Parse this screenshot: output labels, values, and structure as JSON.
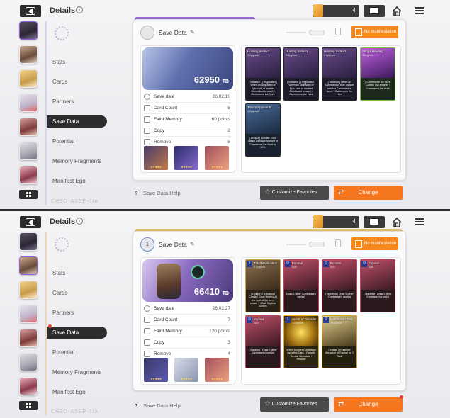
{
  "screens": [
    {
      "header": {
        "title": "Details",
        "currency_value": "4"
      },
      "nav": [
        "Stats",
        "Cards",
        "Partners",
        "Save Data",
        "Potential",
        "Memory Fragments",
        "Manifest Ego"
      ],
      "footer_code": "CHSO-ASSP-3/A",
      "panel": {
        "title": "Save Data",
        "manifestation_label": "No manifestation",
        "banner_value": "62950",
        "banner_unit": "TB",
        "stats": [
          {
            "label": "Save date",
            "value": "26.02.10"
          },
          {
            "label": "Card Count",
            "value": "5"
          },
          {
            "label": "Faint Memory",
            "value": "60 points"
          },
          {
            "label": "Copy",
            "value": "2"
          },
          {
            "label": "Remove",
            "value": "5"
          }
        ],
        "cards": [
          {
            "name": "Hunting Instinct",
            "upgrade": "4 Upgrade",
            "desc": "[ Initiation ] [ Reglicated ] When an Upgraded or Epic card of another Combatant is used, ! Commence the Hunt"
          },
          {
            "name": "Hunting Instinct",
            "upgrade": "4 Upgrade",
            "desc": "[ Initiation ] [ Reglicated ] When an Upgraded or Epic card of another Combatant is used, ! Commence the Hunt"
          },
          {
            "name": "Hunting Instinct",
            "upgrade": "4 Upgrade",
            "desc": "[ Initiation ] When an Upgraded or Epic card of another Combatant is used, ! Commence the Hunt"
          },
          {
            "name": "Stings Howling",
            "upgrade": "4 Upgrade",
            "desc": "[ Commence the Hunt Combo ] All another ! Commence the Hunt"
          },
          {
            "name": "Titan's Approach",
            "upgrade": "4 Upgrade",
            "desc": "[ Unique ] Activate Extra Attack Damage Amount of Commence the Hunt by 40%"
          }
        ]
      },
      "help_label": "Save Data Help",
      "favorites_label": "Customize Favorites",
      "change_label": "Change"
    },
    {
      "header": {
        "title": "Details",
        "currency_value": "4"
      },
      "nav": [
        "Stats",
        "Cards",
        "Partners",
        "Save Data",
        "Potential",
        "Memory Fragments",
        "Manifest Ego"
      ],
      "footer_code": "CHSO-ASSP-3/A",
      "panel": {
        "title": "Save Data",
        "badge_number": "1",
        "manifestation_label": "No manifestation",
        "banner_value": "66410",
        "banner_unit": "TB",
        "stats": [
          {
            "label": "Save date",
            "value": "26.02.27"
          },
          {
            "label": "Card Count",
            "value": "7"
          },
          {
            "label": "Faint Memory",
            "value": "120 points"
          },
          {
            "label": "Copy",
            "value": "3"
          },
          {
            "label": "Remove",
            "value": "4"
          }
        ],
        "cards": [
          {
            "cost": "1",
            "name": "Tidal Replication",
            "upgrade": "4 Upgrade",
            "desc": "[ Unique ] [ Initiation ] Create ! Ghoti Replica At the start of the turn, create 1 Ghoti Replica card(s)"
          },
          {
            "cost": "0",
            "name": "Exposé",
            "upgrade": "Epic",
            "desc": "Draw 2 other Combatant's card(s)"
          },
          {
            "cost": "0",
            "name": "Exposé",
            "upgrade": "Epic",
            "desc": "[ Manifest ] Draw 2 other Combatant's card(s)"
          },
          {
            "cost": "0",
            "name": "Exposé",
            "upgrade": "Epic",
            "desc": "[ Manifest ] Draw 2 other Combatant's card(s)"
          },
          {
            "cost": "0",
            "name": "Exposé",
            "upgrade": "Epic",
            "desc": "[ Manifest ] Draw 2 other Combatant's card(s)"
          },
          {
            "cost": "1",
            "name": "Scent of Disorder",
            "upgrade": "4 Upgrade",
            "desc": "When another Combatant uses this Card, ! Rebuild Reveal ! Unmade, ! Resolve"
          },
          {
            "cost": "2",
            "name": "Retribution Trail",
            "upgrade": "4 Upgrade",
            "desc": "[ Initiate ] Reinforce Attraction of Exposé by 1 Ghoti"
          }
        ]
      },
      "help_label": "Save Data Help",
      "favorites_label": "Customize Favorites",
      "change_label": "Change"
    }
  ]
}
